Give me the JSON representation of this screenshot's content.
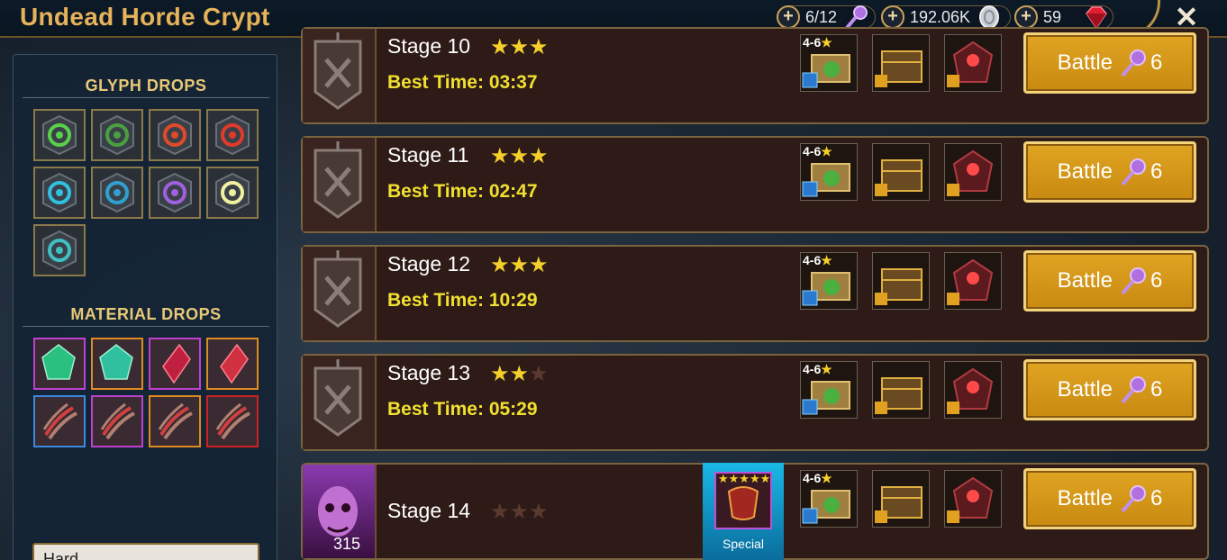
{
  "header": {
    "title": "Undead Horde Crypt",
    "energy": "6/12",
    "silver": "192.06K",
    "gems": "59",
    "close_label": "✕"
  },
  "left_panel": {
    "glyph_title": "GLYPH DROPS",
    "material_title": "MATERIAL DROPS",
    "glyphs": [
      {
        "name": "lifesteal-glyph",
        "color": "#5ad04a"
      },
      {
        "name": "regen-glyph",
        "color": "#4aa040"
      },
      {
        "name": "crit-damage-glyph",
        "color": "#e04a2a"
      },
      {
        "name": "attack-glyph",
        "color": "#e03a2a"
      },
      {
        "name": "defense-glyph",
        "color": "#30c0e0"
      },
      {
        "name": "defense-outline-glyph",
        "color": "#30a0d0"
      },
      {
        "name": "speed-glyph",
        "color": "#a060e0"
      },
      {
        "name": "accuracy-glyph",
        "color": "#f0f0a0"
      },
      {
        "name": "resist-glyph",
        "color": "#40c0c0"
      }
    ],
    "materials": [
      {
        "name": "emerald-stone",
        "border": "#c040d0",
        "color": "#2ac080"
      },
      {
        "name": "emerald-stone",
        "border": "#e08a20",
        "color": "#30c0a0"
      },
      {
        "name": "ruby-shard",
        "border": "#c040d0",
        "color": "#c02040"
      },
      {
        "name": "ruby-shard",
        "border": "#e08a20",
        "color": "#d03040"
      },
      {
        "name": "claw",
        "border": "#3a8ae0",
        "color": "#d04040"
      },
      {
        "name": "claw",
        "border": "#c040d0",
        "color": "#d04040"
      },
      {
        "name": "claw",
        "border": "#e08a20",
        "color": "#d04040"
      },
      {
        "name": "claw",
        "border": "#d02020",
        "color": "#d04040"
      }
    ],
    "difficulty": "Hard"
  },
  "stages": [
    {
      "label": "Stage 10",
      "stars": 3,
      "best_time": "Best Time: 03:37",
      "tag": "4-6",
      "battle_label": "Battle",
      "cost": "6"
    },
    {
      "label": "Stage 11",
      "stars": 3,
      "best_time": "Best Time: 02:47",
      "tag": "4-6",
      "battle_label": "Battle",
      "cost": "6"
    },
    {
      "label": "Stage 12",
      "stars": 3,
      "best_time": "Best Time: 10:29",
      "tag": "4-6",
      "battle_label": "Battle",
      "cost": "6"
    },
    {
      "label": "Stage 13",
      "stars": 2,
      "best_time": "Best Time: 05:29",
      "tag": "4-6",
      "battle_label": "Battle",
      "cost": "6"
    },
    {
      "label": "Stage 14",
      "stars": 0,
      "best_time": "",
      "tag": "4-6",
      "battle_label": "Battle",
      "cost": "6",
      "special_label": "Special",
      "boss_level": "315"
    }
  ]
}
